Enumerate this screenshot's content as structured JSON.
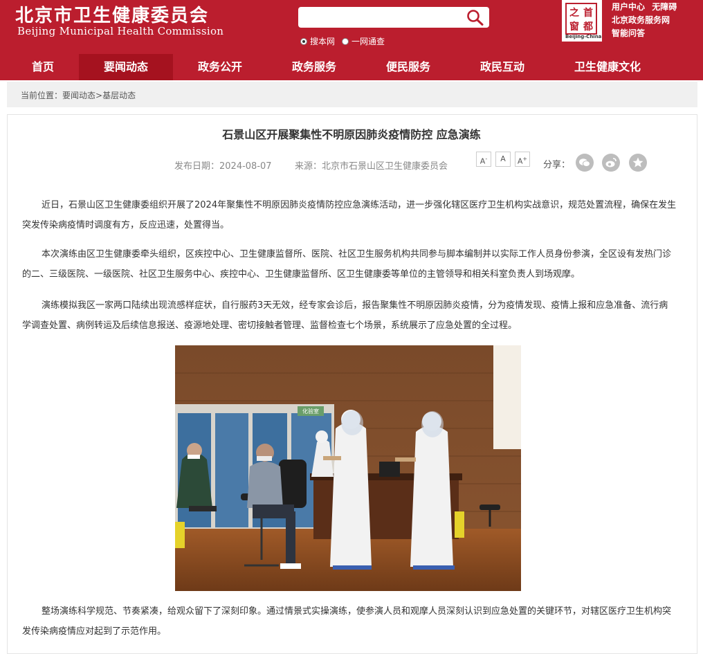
{
  "header": {
    "logo_cn": "北京市卫生健康委员会",
    "logo_en": "Beijing Municipal Health Commission",
    "search": {
      "placeholder": "",
      "options": [
        "搜本网",
        "一网通查"
      ],
      "selected": "搜本网"
    },
    "seal": {
      "chars": [
        "首",
        "都",
        "之",
        "窗"
      ],
      "caption": "Beijing-China"
    },
    "links": {
      "user_center": "用户中心",
      "accessibility": "无障碍",
      "gov_service": "北京政务服务网",
      "smart_qa": "智能问答"
    }
  },
  "nav": {
    "items": [
      "首页",
      "要闻动态",
      "政务公开",
      "政务服务",
      "便民服务",
      "政民互动",
      "卫生健康文化"
    ],
    "active": "要闻动态"
  },
  "breadcrumb": {
    "prefix": "当前位置：",
    "level1": "要闻动态",
    "sep": ">",
    "level2": "基层动态"
  },
  "article": {
    "title": "石景山区开展聚集性不明原因肺炎疫情防控 应急演练",
    "date": "发布日期：2024-08-07",
    "source": "来源：北京市石景山区卫生健康委员会",
    "font_sizes": [
      "A-",
      "A",
      "A+"
    ],
    "share_label": "分享：",
    "share_icons": [
      "wechat-icon",
      "weibo-icon",
      "favorite-icon"
    ],
    "paragraphs": [
      "近日，石景山区卫生健康委组织开展了2024年聚集性不明原因肺炎疫情防控应急演练活动，进一步强化辖区医疗卫生机构实战意识，规范处置流程，确保在发生突发传染病疫情时调度有方，反应迅速，处置得当。",
      "本次演练由区卫生健康委牵头组织，区疾控中心、卫生健康监督所、医院、社区卫生服务机构共同参与脚本编制并以实际工作人员身份参演，全区设有发热门诊的二、三级医院、一级医院、社区卫生服务中心、疾控中心、卫生健康监督所、区卫生健康委等单位的主管领导和相关科室负责人到场观摩。",
      "演练模拟我区一家两口陆续出现流感样症状，自行服药3天无效，经专家会诊后，报告聚集性不明原因肺炎疫情，分为疫情发现、疫情上报和应急准备、流行病学调查处置、病例转运及后续信息报送、疫源地处理、密切接触者管理、监督检查七个场景，系统展示了应急处置的全过程。",
      "整场演练科学规范、节奏紧凑，给观众留下了深刻印象。通过情景式实操演练，使参演人员和观摩人员深刻认识到应急处置的关键环节，对辖区医疗卫生机构突发传染病疫情应对起到了示范作用。"
    ],
    "photo_sign": "化验室"
  },
  "colors": {
    "brand_red": "#bb1e2e",
    "nav_active": "#a5121f",
    "breadcrumb_bg": "#f0f0f0"
  }
}
